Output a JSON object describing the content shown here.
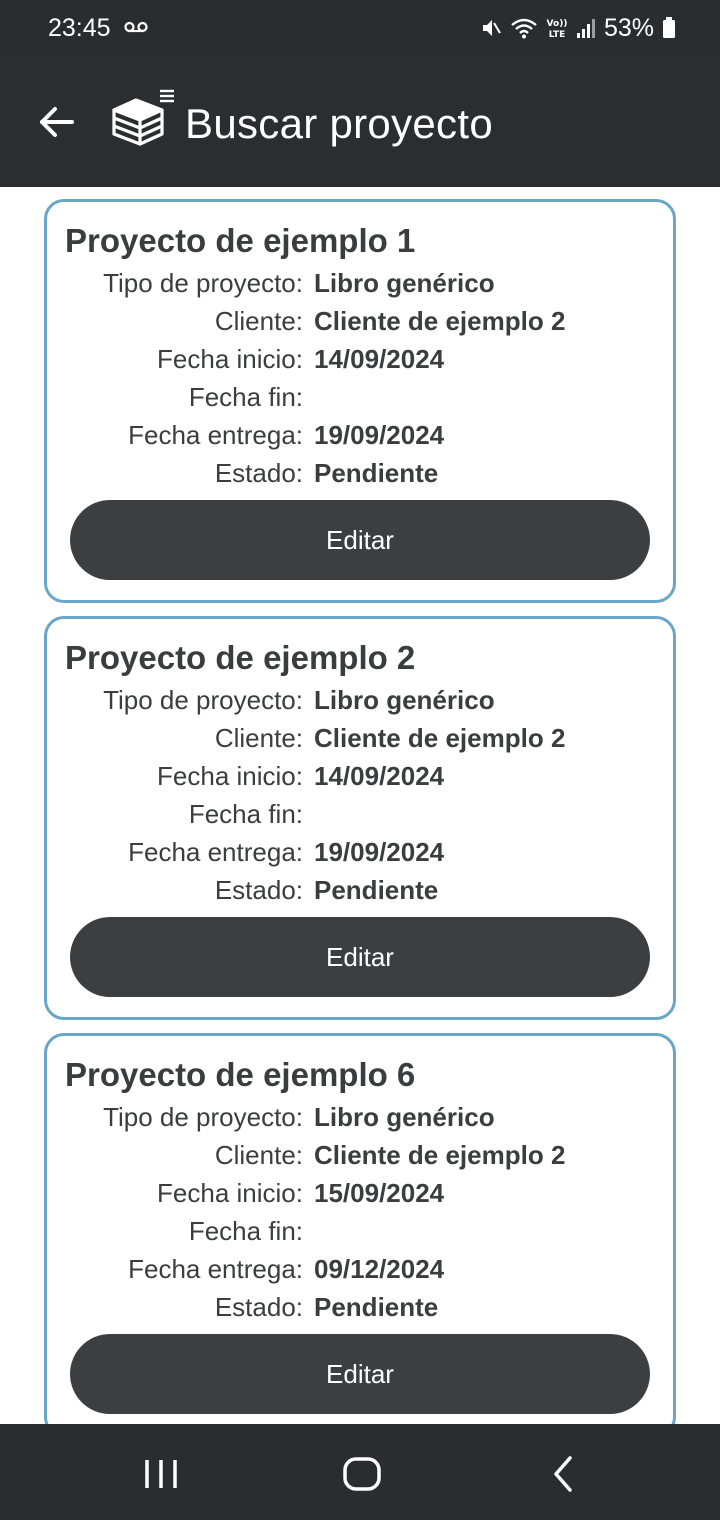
{
  "status_bar": {
    "time": "23:45",
    "battery": "53%",
    "icons": [
      "voicemail-icon",
      "mute-icon",
      "wifi-icon",
      "volte-icon",
      "signal-icon",
      "battery-icon"
    ]
  },
  "app_bar": {
    "title": "Buscar proyecto",
    "back_icon": "arrow-left-icon",
    "logo_icon": "stacked-books-list-icon"
  },
  "colors": {
    "bar_background": "#2a2d30",
    "card_border": "#6aa7c7",
    "button_background": "#3c3f42",
    "text": "#3b3c40"
  },
  "labels": {
    "tipo": "Tipo de proyecto:",
    "cliente": "Cliente:",
    "fecha_inicio": "Fecha inicio:",
    "fecha_fin": "Fecha fin:",
    "fecha_entrega": "Fecha entrega:",
    "estado": "Estado:"
  },
  "projects": [
    {
      "title": "Proyecto de ejemplo 1",
      "tipo": "Libro genérico",
      "cliente": "Cliente de ejemplo 2",
      "fecha_inicio": "14/09/2024",
      "fecha_fin": "",
      "fecha_entrega": "19/09/2024",
      "estado": "Pendiente",
      "button_label": "Editar"
    },
    {
      "title": "Proyecto de ejemplo 2",
      "tipo": "Libro genérico",
      "cliente": "Cliente de ejemplo 2",
      "fecha_inicio": "14/09/2024",
      "fecha_fin": "",
      "fecha_entrega": "19/09/2024",
      "estado": "Pendiente",
      "button_label": "Editar"
    },
    {
      "title": "Proyecto de ejemplo 6",
      "tipo": "Libro genérico",
      "cliente": "Cliente de ejemplo 2",
      "fecha_inicio": "15/09/2024",
      "fecha_fin": "",
      "fecha_entrega": "09/12/2024",
      "estado": "Pendiente",
      "button_label": "Editar"
    }
  ],
  "nav_bar": {
    "icons": [
      "recent-apps-icon",
      "home-icon",
      "back-icon"
    ]
  }
}
